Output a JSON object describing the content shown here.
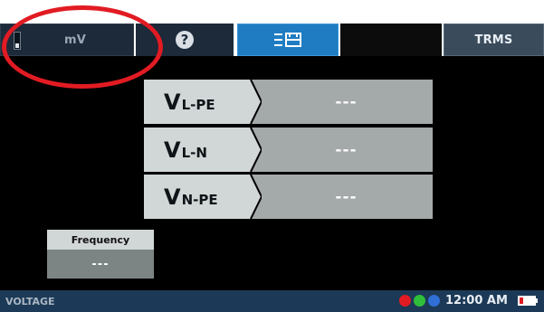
{
  "toolbar": {
    "range_label": "mV",
    "range_level": 0.3,
    "help_icon": "help-icon",
    "menu_icon": "menu-save-icon",
    "trms_label": "TRMS"
  },
  "measurements": [
    {
      "main": "V",
      "sub": "L-PE",
      "value": "---"
    },
    {
      "main": "V",
      "sub": "L-N",
      "value": "---"
    },
    {
      "main": "V",
      "sub": "N-PE",
      "value": "---"
    }
  ],
  "frequency": {
    "label": "Frequency",
    "value": "---"
  },
  "status": {
    "mode": "VOLTAGE",
    "time": "12:00 AM",
    "dot_colors": [
      "#e21b23",
      "#2fbf3a",
      "#2f6fd6"
    ],
    "battery_level": 0.2
  },
  "colors": {
    "accent_blue": "#1f7cc2",
    "annotation_red": "#e21b23"
  }
}
